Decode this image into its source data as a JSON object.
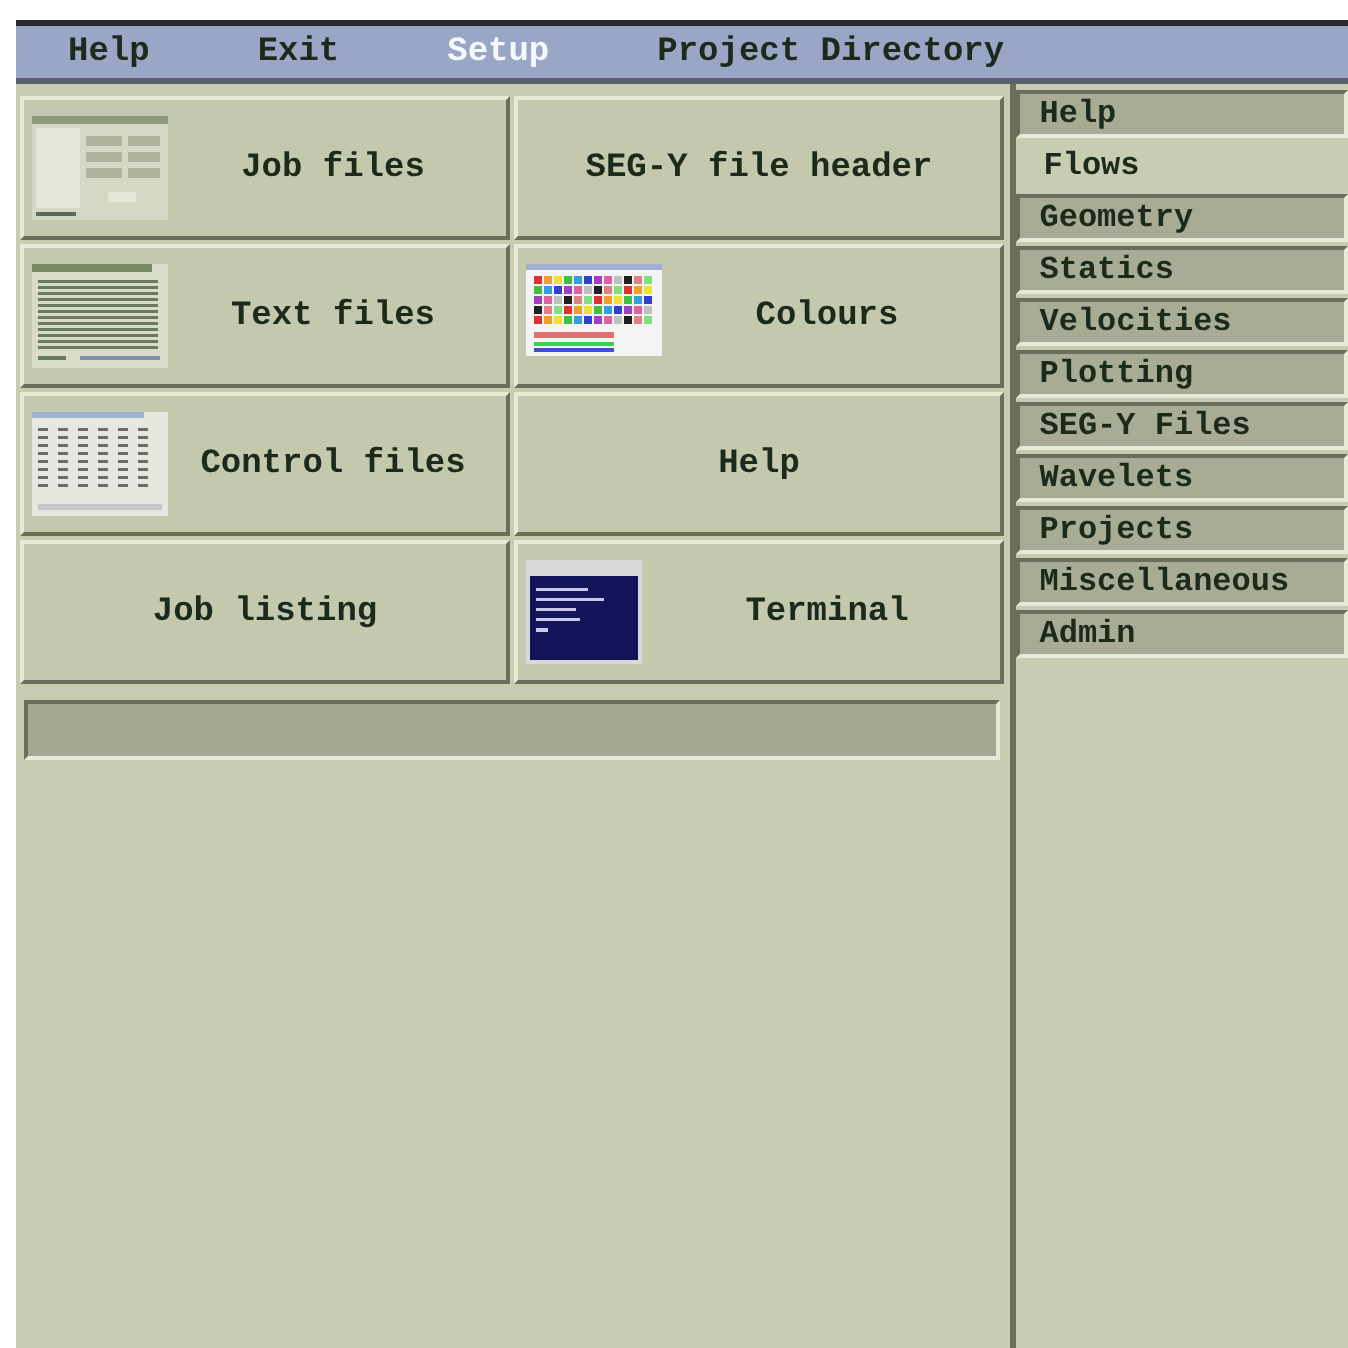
{
  "menu": [
    {
      "label": "Help",
      "disabled": false
    },
    {
      "label": "Exit",
      "disabled": false
    },
    {
      "label": "Setup",
      "disabled": true
    },
    {
      "label": "Project Directory",
      "disabled": false
    }
  ],
  "buttons": [
    {
      "label": "Job files",
      "kind": "form"
    },
    {
      "label": "SEG-Y file header",
      "kind": "plain"
    },
    {
      "label": "Text files",
      "kind": "document"
    },
    {
      "label": "Colours",
      "kind": "palette"
    },
    {
      "label": "Control files",
      "kind": "table"
    },
    {
      "label": "Help",
      "kind": "plain"
    },
    {
      "label": "Job listing",
      "kind": "plain"
    },
    {
      "label": "Terminal",
      "kind": "terminal"
    }
  ],
  "sidebar": {
    "items": [
      {
        "label": "Help",
        "selected": false
      },
      {
        "label": "Flows",
        "selected": true
      },
      {
        "label": "Geometry",
        "selected": false
      },
      {
        "label": "Statics",
        "selected": false
      },
      {
        "label": "Velocities",
        "selected": false
      },
      {
        "label": "Plotting",
        "selected": false
      },
      {
        "label": "SEG-Y Files",
        "selected": false
      },
      {
        "label": "Wavelets",
        "selected": false
      },
      {
        "label": "Projects",
        "selected": false
      },
      {
        "label": "Miscellaneous",
        "selected": false
      },
      {
        "label": "Admin",
        "selected": false
      }
    ]
  }
}
